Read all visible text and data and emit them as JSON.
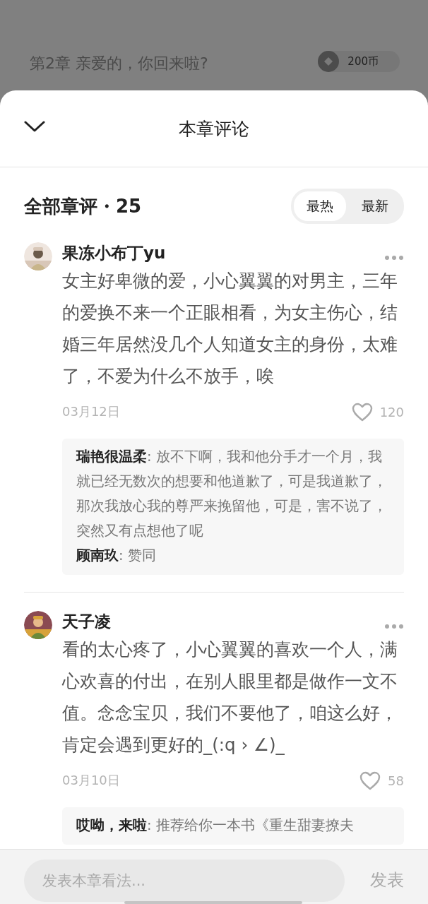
{
  "background": {
    "chapter_title": "第2章 亲爱的，你回来啦?",
    "price": "200币"
  },
  "sheet": {
    "title": "本章评论",
    "heading": "全部章评・25",
    "sort_tabs": [
      {
        "label": "最热",
        "selected": true
      },
      {
        "label": "最新",
        "selected": false
      }
    ]
  },
  "comments": [
    {
      "author": "果冻小布丁yu",
      "text": "女主好卑微的爱，小心翼翼的对男主，三年的爱换不来一个正眼相看，为女主伤心，结婚三年居然没几个人知道女主的身份，太难了，不爱为什么不放手，唉",
      "date": "03月12日",
      "likes": "120",
      "liked": false,
      "replies": [
        "**瑞艳很温柔**: 放不下啊，我和他分手才一个月，我就已经无数次的想要和他道歉了，可是我道歉了，那次我放心我的尊严来挽留他，可是，害不说了，突然又有点想他了呢",
        "**顾南玖**: 赞同"
      ]
    },
    {
      "author": "天子凌",
      "text": "看的太心疼了，小心翼翼的喜欢一个人，满心欢喜的付出，在别人眼里都是做作一文不值。念念宝贝，我们不要他了，咱这么好，肯定会遇到更好的_(:q › ∠)_",
      "date": "03月10日",
      "likes": "58",
      "liked": false,
      "replies": [
        "**哎呦，来啦**: 推荐给你一本书《重生甜妻撩夫"
      ]
    }
  ],
  "footer": {
    "placeholder": "发表本章看法...",
    "send": "发表"
  }
}
